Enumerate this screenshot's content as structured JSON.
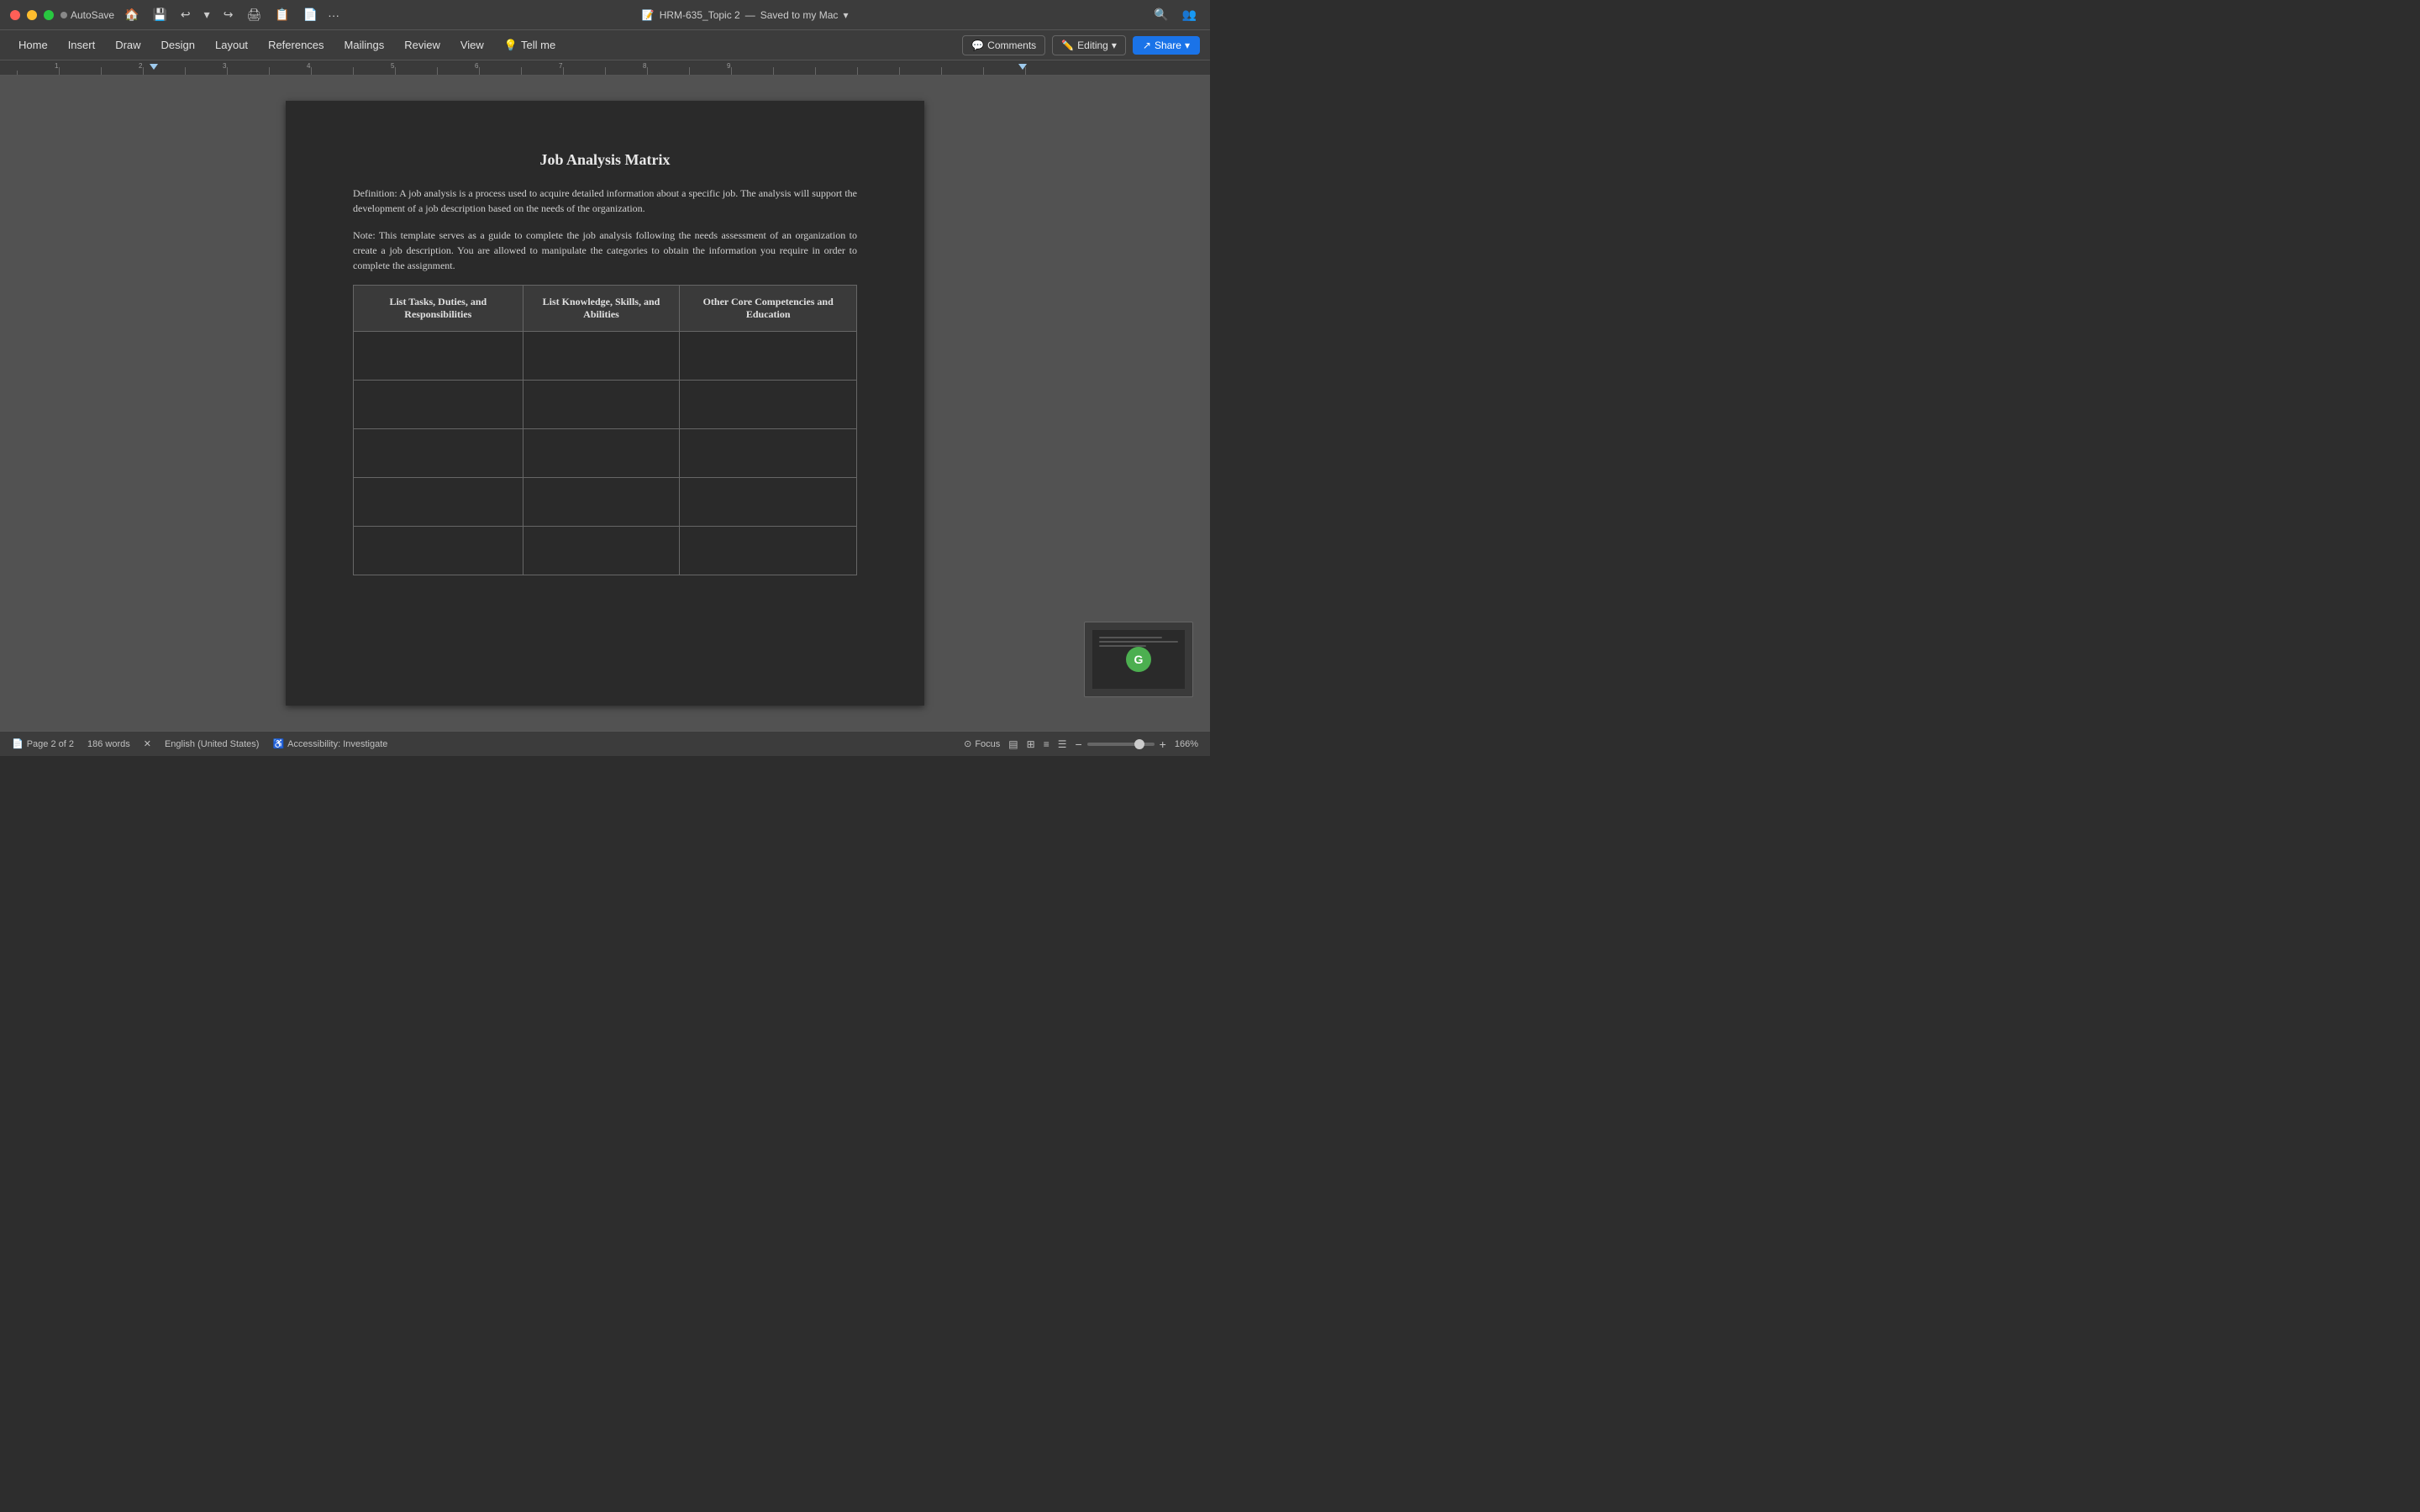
{
  "titlebar": {
    "autosave": "AutoSave",
    "doc_title": "HRM-635_Topic 2",
    "save_status": "Saved to my Mac",
    "window_icon": "📄"
  },
  "menubar": {
    "items": [
      "Home",
      "Insert",
      "Draw",
      "Design",
      "Layout",
      "References",
      "Mailings",
      "Review",
      "View",
      "Tell me"
    ],
    "tell_me_placeholder": "Tell me",
    "comments_label": "Comments",
    "editing_label": "Editing",
    "share_label": "Share"
  },
  "document": {
    "title": "Job Analysis Matrix",
    "para1": "Definition: A job analysis is a process used to acquire detailed information about a specific job. The analysis will support the development of a job description based on the needs of the organization.",
    "para2": "Note: This template serves as a guide to complete the job analysis following the needs assessment of an organization to create a job description. You are allowed to manipulate the categories to obtain the information you require in order to complete the assignment.",
    "table": {
      "headers": [
        "List Tasks, Duties, and Responsibilities",
        "List Knowledge, Skills, and Abilities",
        "Other Core Competencies and Education"
      ],
      "rows": 5
    }
  },
  "statusbar": {
    "page_info": "Page 2 of 2",
    "word_count": "186 words",
    "language": "English (United States)",
    "accessibility": "Accessibility: Investigate",
    "focus_label": "Focus",
    "zoom_level": "166%"
  },
  "thumbnail": {
    "avatar_letter": "G"
  }
}
